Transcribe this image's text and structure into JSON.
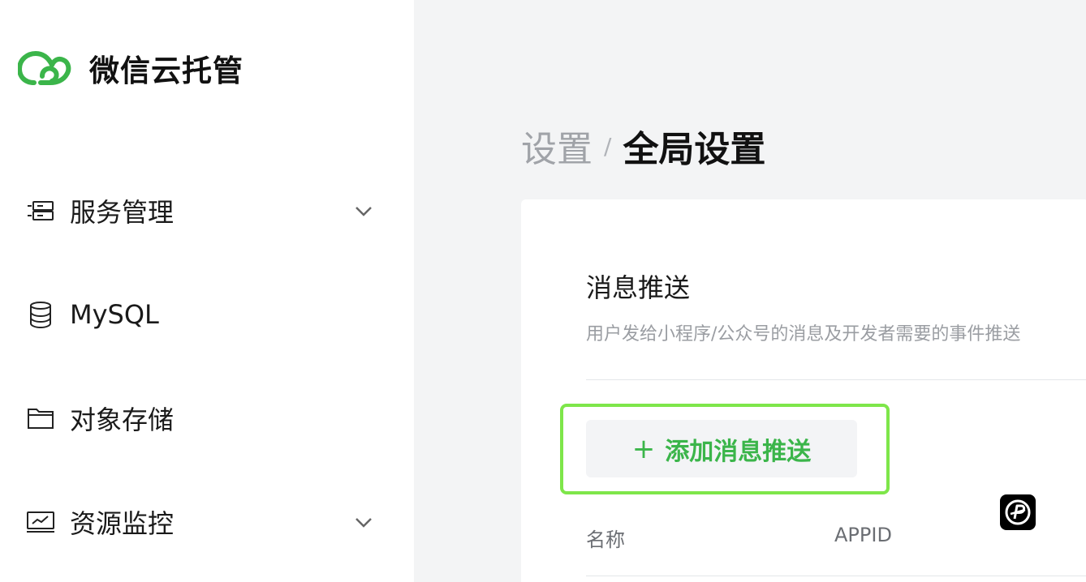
{
  "app": {
    "name": "微信云托管",
    "accent_color": "#3bb54a"
  },
  "sidebar": {
    "items": [
      {
        "label": "服务管理",
        "icon": "server-icon",
        "has_chevron": true
      },
      {
        "label": "MySQL",
        "icon": "database-icon",
        "has_chevron": false
      },
      {
        "label": "对象存储",
        "icon": "folder-icon",
        "has_chevron": false
      },
      {
        "label": "资源监控",
        "icon": "monitor-chart-icon",
        "has_chevron": true
      }
    ]
  },
  "breadcrumb": {
    "parent": "设置",
    "separator": "/",
    "current": "全局设置"
  },
  "section": {
    "title": "消息推送",
    "description": "用户发给小程序/公众号的消息及开发者需要的事件推送",
    "add_button_icon": "+",
    "add_button_label": "添加消息推送"
  },
  "table": {
    "columns": [
      "名称",
      "APPID"
    ]
  },
  "floating_badge": {
    "icon": "p-logo-icon"
  }
}
